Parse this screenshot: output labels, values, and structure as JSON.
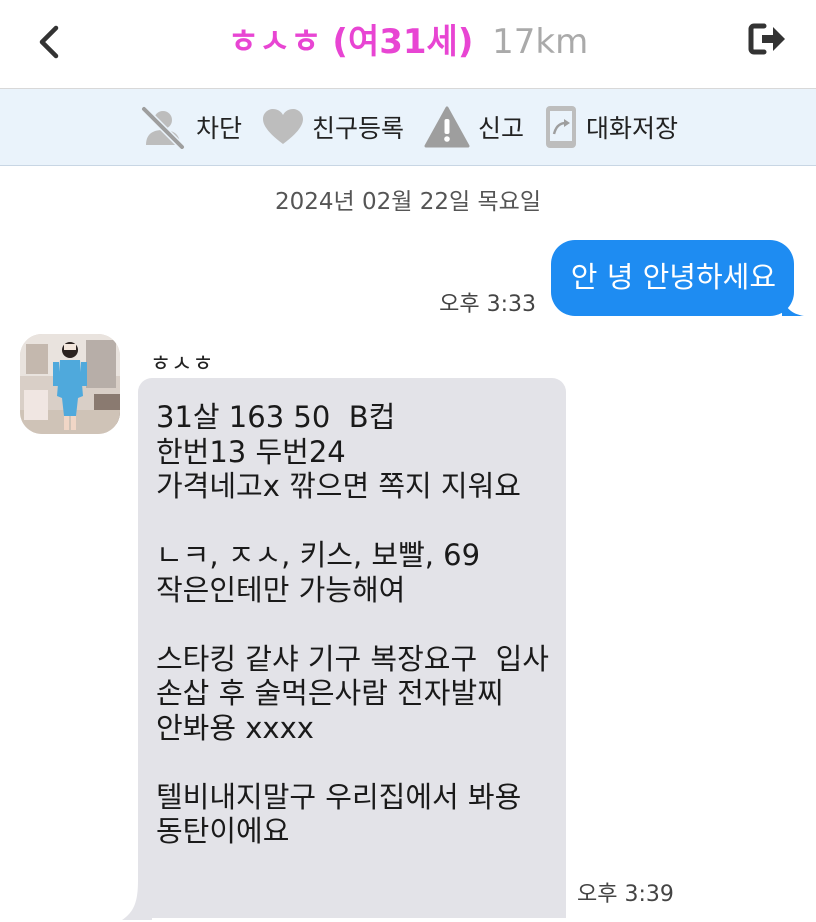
{
  "header": {
    "name": "ㅎㅅㅎ",
    "age": "(여31세)",
    "distance": "17km"
  },
  "actions": [
    {
      "label": "차단",
      "icon": "block-user-icon"
    },
    {
      "label": "친구등록",
      "icon": "heart-icon"
    },
    {
      "label": "신고",
      "icon": "warning-icon"
    },
    {
      "label": "대화저장",
      "icon": "save-chat-icon"
    }
  ],
  "date": "2024년 02월 22일 목요일",
  "messages": {
    "outgoing": {
      "text": "안 녕 안녕하세요",
      "time": "오후 3:33"
    },
    "incoming": {
      "sender": "ㅎㅅㅎ",
      "text": "31살 163 50  B컵\n한번13 두번24\n가격네고x 깎으면 쪽지 지워요\n\nㄴㅋ, ㅈㅅ, 키스, 보빨, 69\n작은인테만 가능해여\n\n스타킹 같샤 기구 복장요구  입사\n손삽 후 술먹은사람 전자발찌\n안봐용 xxxx\n\n텔비내지말구 우리집에서 봐용\n동탄이에요",
      "time": "오후 3:39"
    }
  },
  "colors": {
    "accent_pink": "#e845d3",
    "bubble_blue": "#1e8cf2",
    "bubble_gray": "#e3e3e8",
    "action_bar_bg": "#eaf3fb"
  }
}
